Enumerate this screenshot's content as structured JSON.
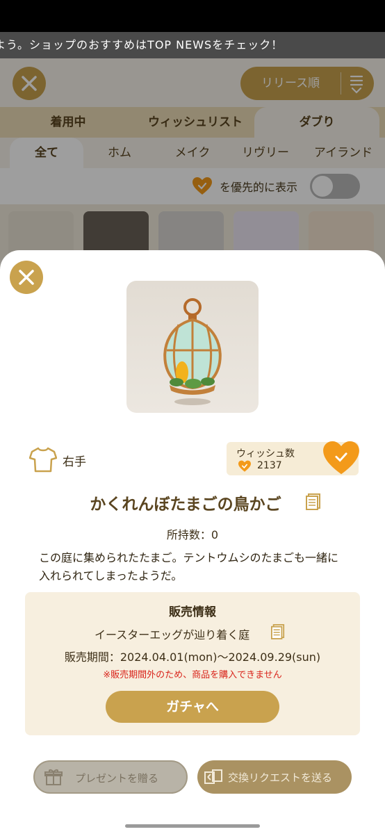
{
  "ticker": {
    "text": "よう。ショップのおすすめはTOP NEWSをチェック！"
  },
  "header": {
    "close_icon": "close-icon",
    "sort_label": "リリース順",
    "sort_icon": "sort-icon"
  },
  "tabs_primary": [
    {
      "label": "着用中"
    },
    {
      "label": "ウィッシュリスト"
    },
    {
      "label": "ダブり",
      "active": true
    }
  ],
  "tabs_secondary": [
    {
      "label": "全て",
      "active": true
    },
    {
      "label": "ホム"
    },
    {
      "label": "メイク"
    },
    {
      "label": "リヴリー"
    },
    {
      "label": "アイランド"
    }
  ],
  "filter": {
    "label": "を優先的に表示",
    "toggle_on": false
  },
  "item": {
    "slot": "右手",
    "wish_title": "ウィッシュ数",
    "wish_count": "2137",
    "wished": true,
    "name": "かくれんぼたまごの鳥かご",
    "owned": "所持数：0",
    "description": "この庭に集められたたまご。テントウムシのたまごも一緒に入れられてしまったようだ。"
  },
  "sale": {
    "title": "販売情報",
    "event": "イースターエッグが辿り着く庭",
    "period": "販売期間：2024.04.01(mon)～2024.09.29(sun)",
    "warning": "※販売期間外のため、商品を購入できません",
    "gacha_button": "ガチャへ"
  },
  "actions": {
    "present_button": "プレゼントを贈る",
    "trade_button": "交換リクエストを送る"
  },
  "colors": {
    "accent": "#c9a24e",
    "heart": "#f39a1a",
    "warning": "#d9241b"
  }
}
